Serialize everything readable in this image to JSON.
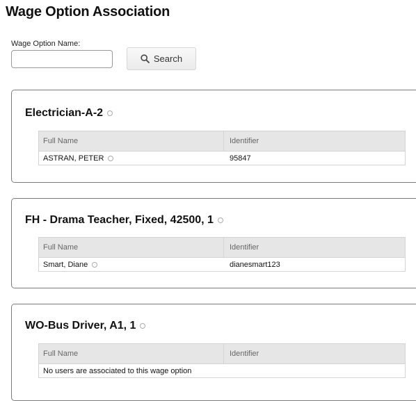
{
  "page": {
    "title": "Wage Option Association"
  },
  "search": {
    "label": "Wage Option Name:",
    "value": "",
    "button_label": "Search"
  },
  "columns": {
    "full_name": "Full Name",
    "identifier": "Identifier"
  },
  "wage_options": [
    {
      "title": "Electrician-A-2",
      "rows": [
        {
          "full_name": "ASTRAN, PETER",
          "identifier": "95847"
        }
      ]
    },
    {
      "title": "FH - Drama Teacher, Fixed, 42500, 1",
      "rows": [
        {
          "full_name": "Smart, Diane",
          "identifier": "dianesmart123"
        }
      ]
    },
    {
      "title": "WO-Bus Driver, A1, 1",
      "rows": [],
      "empty_message": "No users are associated to this wage option"
    }
  ],
  "colors": {
    "header_bg": "#e6e6e6",
    "card_border": "#7a7a7a",
    "grid_border": "#d4d4d4"
  }
}
